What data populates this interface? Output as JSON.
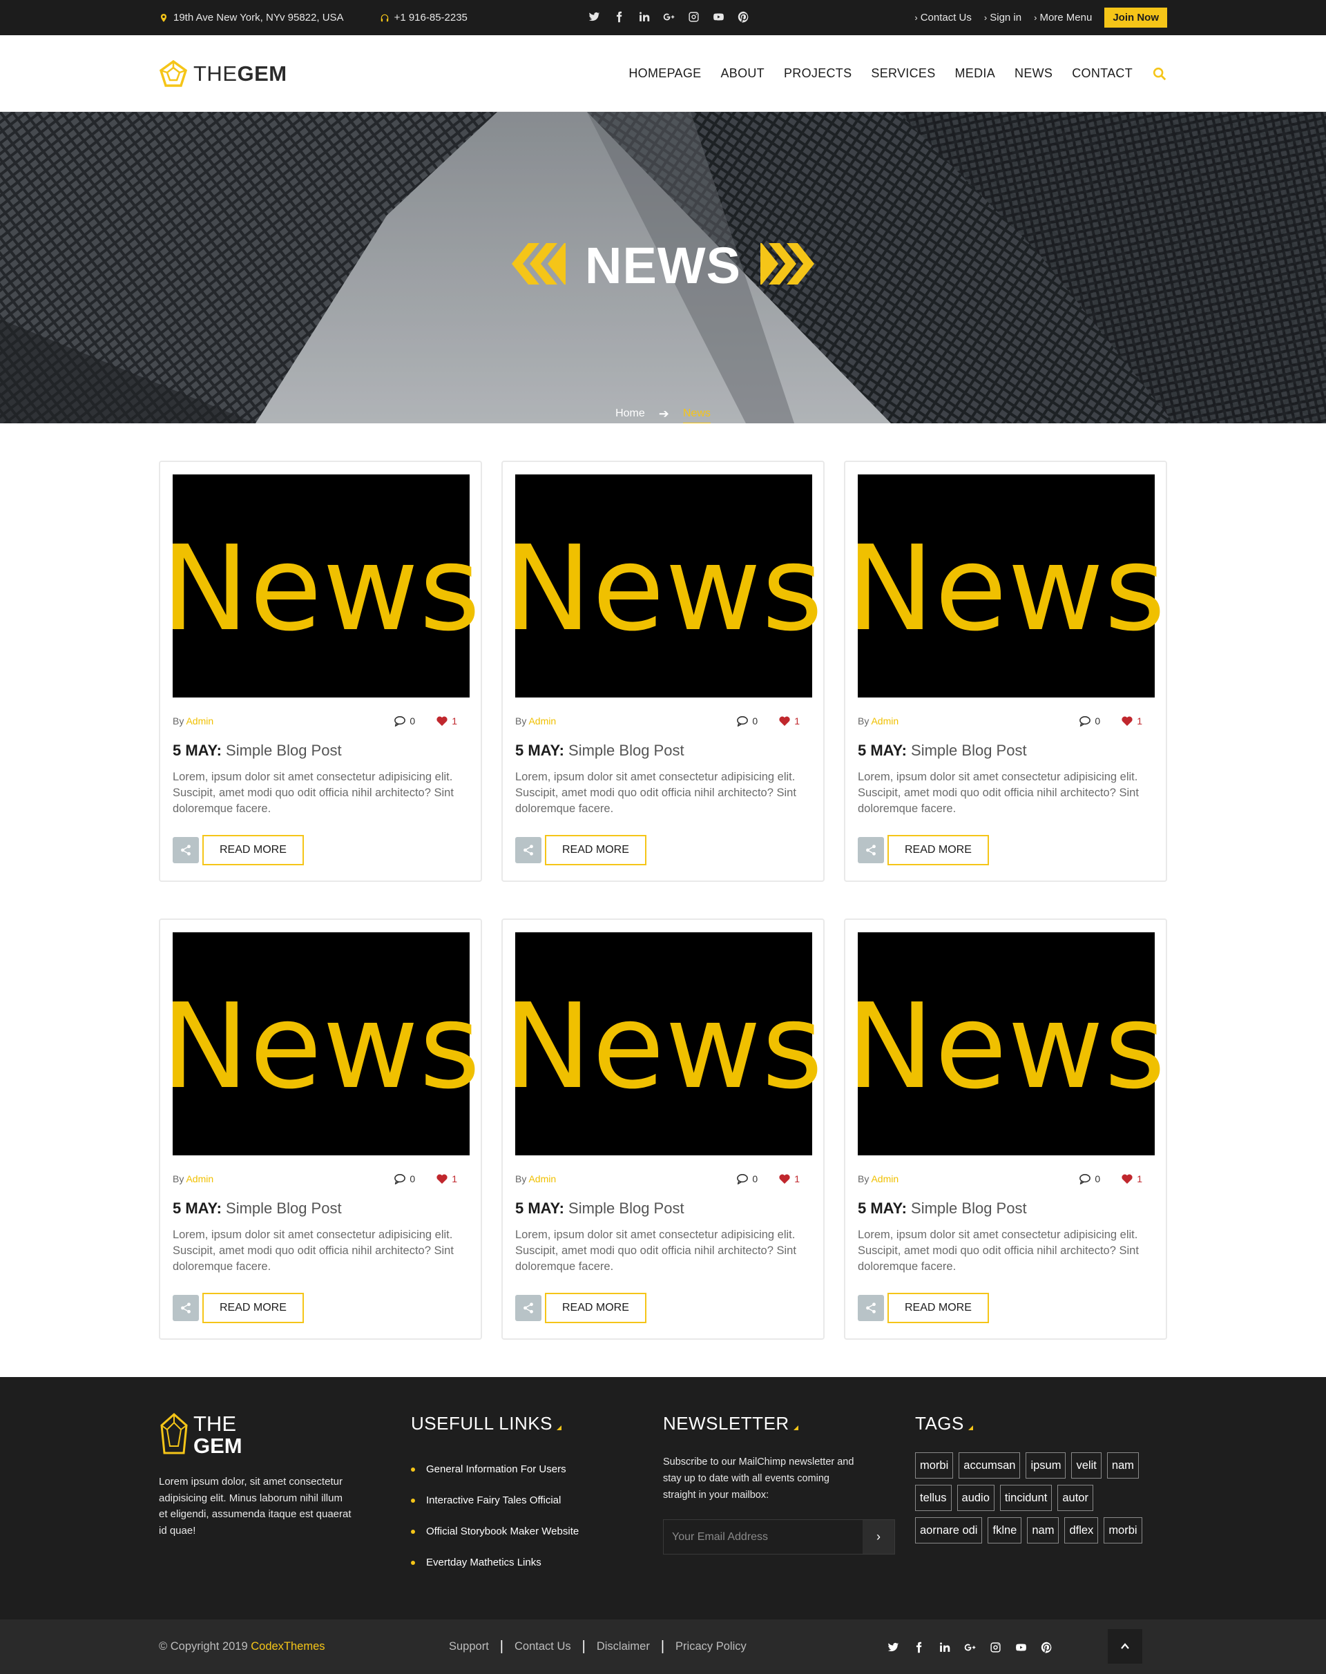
{
  "topbar": {
    "address": "19th Ave New York, NYv 95822, USA",
    "phone": "+1 916-85-2235",
    "social_icons": [
      "twitter-icon",
      "facebook-icon",
      "linkedin-icon",
      "google-plus-icon",
      "instagram-icon",
      "youtube-icon",
      "pinterest-icon"
    ],
    "links": [
      "Contact Us",
      "Sign in",
      "More Menu"
    ],
    "join_label": "Join Now"
  },
  "header": {
    "logo_light": "THE",
    "logo_bold": "GEM",
    "nav": [
      "HOMEPAGE",
      "ABOUT",
      "PROJECTS",
      "SERVICES",
      "MEDIA",
      "NEWS",
      "CONTACT"
    ]
  },
  "hero": {
    "title": "NEWS",
    "breadcrumb_home": "Home",
    "breadcrumb_current": "News"
  },
  "posts": [
    {
      "image_text": "News",
      "by": "By",
      "author": "Admin",
      "comments": "0",
      "likes": "1",
      "date": "5 MAY:",
      "title": "Simple Blog Post",
      "excerpt": "Lorem, ipsum dolor sit amet consectetur adipisicing elit. Suscipit, amet modi quo odit officia nihil architecto? Sint doloremque facere.",
      "read_more": "READ MORE"
    },
    {
      "image_text": "News",
      "by": "By",
      "author": "Admin",
      "comments": "0",
      "likes": "1",
      "date": "5 MAY:",
      "title": "Simple Blog Post",
      "excerpt": "Lorem, ipsum dolor sit amet consectetur adipisicing elit. Suscipit, amet modi quo odit officia nihil architecto? Sint doloremque facere.",
      "read_more": "READ MORE"
    },
    {
      "image_text": "News",
      "by": "By",
      "author": "Admin",
      "comments": "0",
      "likes": "1",
      "date": "5 MAY:",
      "title": "Simple Blog Post",
      "excerpt": "Lorem, ipsum dolor sit amet consectetur adipisicing elit. Suscipit, amet modi quo odit officia nihil architecto? Sint doloremque facere.",
      "read_more": "READ MORE"
    },
    {
      "image_text": "News",
      "by": "By",
      "author": "Admin",
      "comments": "0",
      "likes": "1",
      "date": "5 MAY:",
      "title": "Simple Blog Post",
      "excerpt": "Lorem, ipsum dolor sit amet consectetur adipisicing elit. Suscipit, amet modi quo odit officia nihil architecto? Sint doloremque facere.",
      "read_more": "READ MORE"
    },
    {
      "image_text": "News",
      "by": "By",
      "author": "Admin",
      "comments": "0",
      "likes": "1",
      "date": "5 MAY:",
      "title": "Simple Blog Post",
      "excerpt": "Lorem, ipsum dolor sit amet consectetur adipisicing elit. Suscipit, amet modi quo odit officia nihil architecto? Sint doloremque facere.",
      "read_more": "READ MORE"
    },
    {
      "image_text": "News",
      "by": "By",
      "author": "Admin",
      "comments": "0",
      "likes": "1",
      "date": "5 MAY:",
      "title": "Simple Blog Post",
      "excerpt": "Lorem, ipsum dolor sit amet consectetur adipisicing elit. Suscipit, amet modi quo odit officia nihil architecto? Sint doloremque facere.",
      "read_more": "READ MORE"
    }
  ],
  "footer": {
    "logo_light": "THE",
    "logo_bold": "GEM",
    "about": "Lorem ipsum dolor, sit amet consectetur adipisicing elit. Minus laborum nihil illum et eligendi, assumenda itaque est quaerat id quae!",
    "links_heading": "USEFULL LINKS",
    "links": [
      "General Information For Users",
      "Interactive Fairy Tales Official",
      "Official Storybook Maker Website",
      "Evertday Mathetics Links"
    ],
    "newsletter_heading": "NEWSLETTER",
    "newsletter_text": "Subscribe to our MailChimp newsletter and stay up to date with all events coming straight in your mailbox:",
    "email_placeholder": "Your Email Address",
    "tags_heading": "TAGS",
    "tags": [
      "morbi",
      "accumsan",
      "ipsum",
      "velit",
      "nam",
      "tellus",
      "audio",
      "tincidunt",
      "autor",
      "aornare odi",
      "fklne",
      "nam",
      "dflex",
      "morbi"
    ]
  },
  "bottombar": {
    "copyright_prefix": "© Copyright 2019 ",
    "copyright_brand": "CodexThemes",
    "links": [
      "Support",
      "Contact Us",
      "Disclaimer",
      "Pricacy Policy"
    ]
  },
  "colors": {
    "accent": "#f5c518",
    "dark": "#1c1c1c",
    "like": "#c0272d"
  }
}
